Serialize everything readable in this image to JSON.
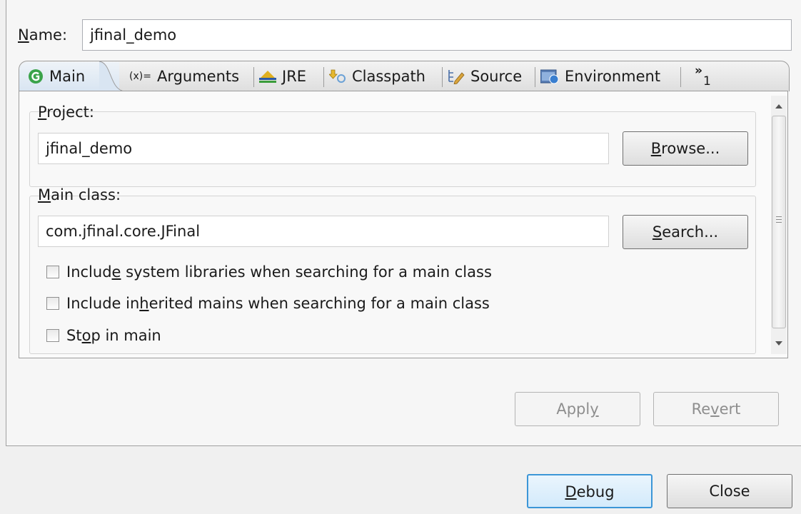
{
  "config": {
    "name_label": "Name:",
    "name_value": "jfinal_demo"
  },
  "tabs": [
    {
      "label": "Main",
      "icon": "main-class-icon"
    },
    {
      "label": "Arguments",
      "icon": "arguments-icon"
    },
    {
      "label": "JRE",
      "icon": "jre-icon"
    },
    {
      "label": "Classpath",
      "icon": "classpath-icon"
    },
    {
      "label": "Source",
      "icon": "source-icon"
    },
    {
      "label": "Environment",
      "icon": "environment-icon"
    }
  ],
  "tab_overflow": {
    "chevron": "»",
    "count": "1"
  },
  "project": {
    "label": "Project:",
    "value": "jfinal_demo",
    "browse_label": "Browse..."
  },
  "main_class": {
    "label": "Main class:",
    "value": "com.jfinal.core.JFinal",
    "search_label": "Search..."
  },
  "options": [
    {
      "label": "Include system libraries when searching for a main class",
      "checked": false
    },
    {
      "label": "Include inherited mains when searching for a main class",
      "checked": false
    },
    {
      "label": "Stop in main",
      "checked": false
    }
  ],
  "actions": {
    "apply_label": "Apply",
    "revert_label": "Revert"
  },
  "dialog": {
    "debug_label": "Debug",
    "close_label": "Close"
  },
  "colors": {
    "focus_border": "#3c96d7",
    "main_icon_green": "#3aa34a",
    "active_tab": "#d9e5f2"
  }
}
